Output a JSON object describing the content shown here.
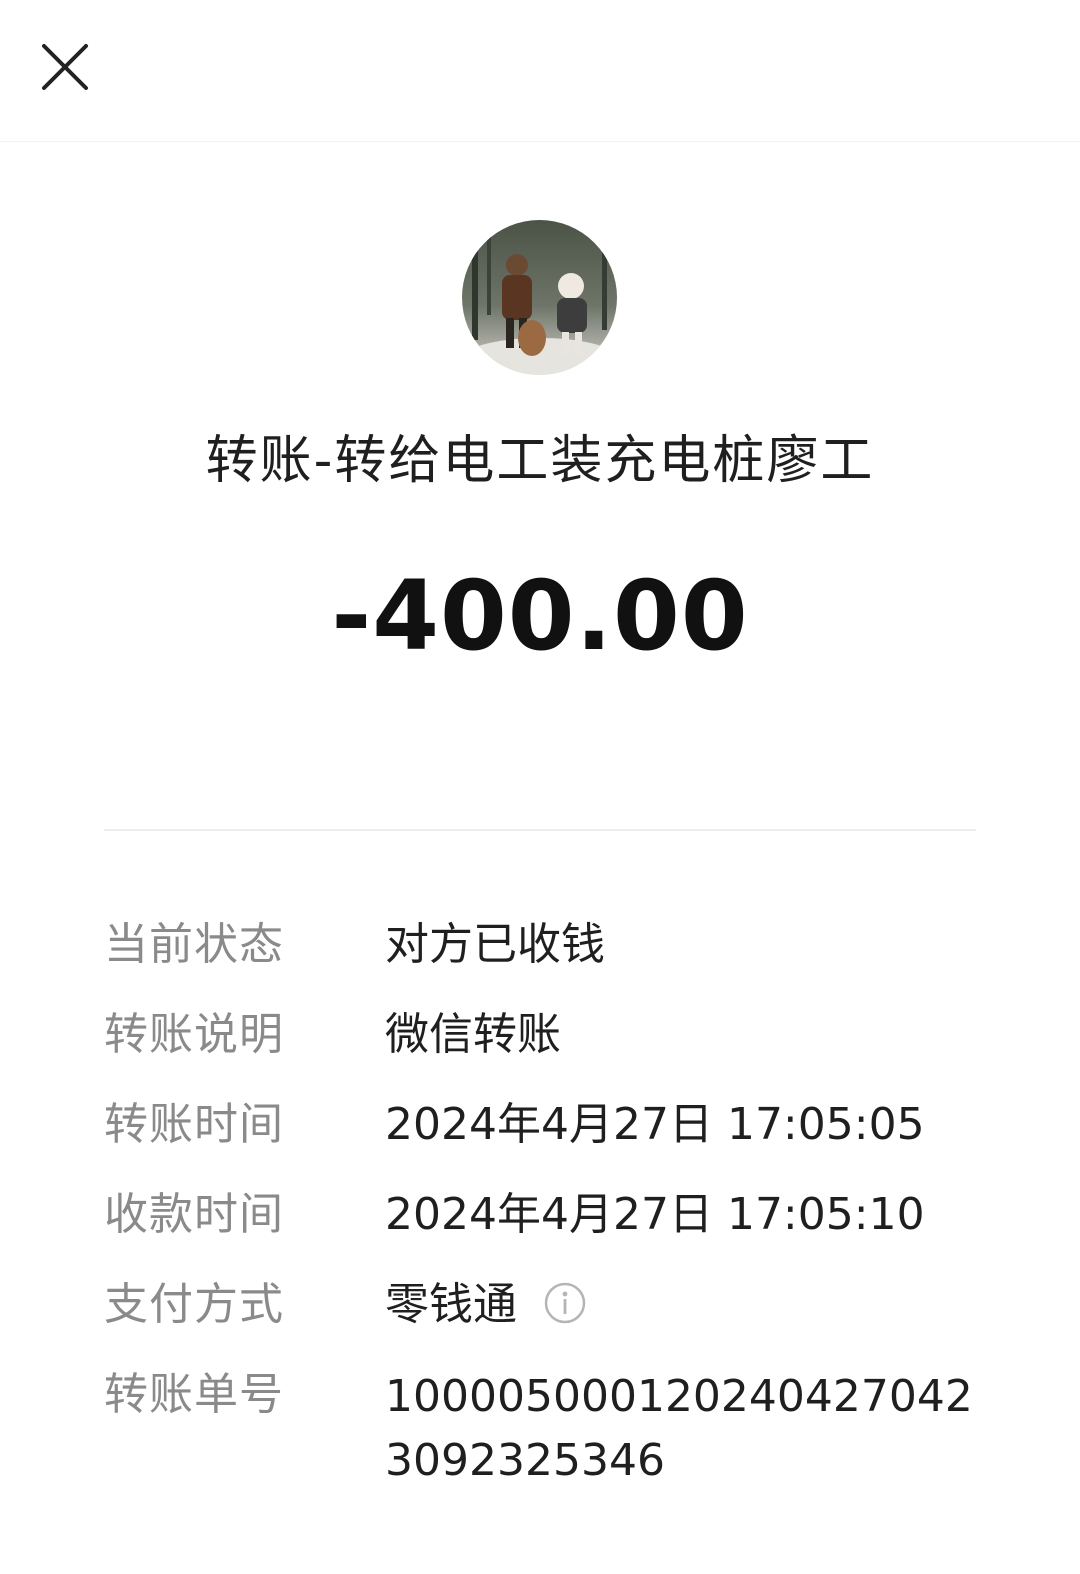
{
  "header": {
    "close_icon": "close-icon"
  },
  "transaction": {
    "title": "转账-转给电工装充电桩廖工",
    "amount": "-400.00"
  },
  "details": [
    {
      "label": "当前状态",
      "value": "对方已收钱"
    },
    {
      "label": "转账说明",
      "value": "微信转账"
    },
    {
      "label": "转账时间",
      "value": "2024年4月27日 17:05:05"
    },
    {
      "label": "收款时间",
      "value": "2024年4月27日 17:05:10"
    },
    {
      "label": "支付方式",
      "value": "零钱通",
      "icon": "info-icon"
    },
    {
      "label": "转账单号",
      "value": "100005000120240427042309232 5346"
    }
  ],
  "colors": {
    "label": "#8a8a8a",
    "text": "#1f1f1f",
    "divider": "#ececec"
  }
}
